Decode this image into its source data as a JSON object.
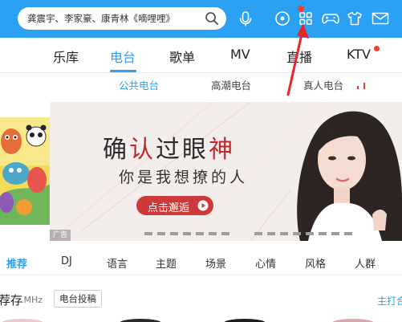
{
  "search": {
    "text": "龚震宇、李家豪、康青林《嘀哩哩》"
  },
  "main_nav": {
    "items": [
      "乐库",
      "电台",
      "歌单",
      "MV",
      "直播",
      "KTV"
    ],
    "active": "电台"
  },
  "sub_nav": {
    "items": [
      "公共电台",
      "高潮电台",
      "真人电台"
    ],
    "active": "公共电台"
  },
  "banner": {
    "headline": "确认过眼神",
    "subline": "你是我想撩的人",
    "button": "点击邂逅",
    "ad_badge": "广告"
  },
  "categories": {
    "items": [
      "推荐",
      "DJ",
      "语言",
      "主题",
      "场景",
      "心情",
      "风格",
      "人群"
    ],
    "active": "推荐"
  },
  "section": {
    "title": "荐存",
    "unit": ".MHz",
    "submit_button": "电台投稿",
    "right_link": "主打合"
  },
  "colors": {
    "accent": "#2aa1f2",
    "badge_red": "#ff3b30",
    "banner_button": "#cc3b3a",
    "banner_red_text": "#c0272d"
  },
  "icons": [
    "search-icon",
    "mic-icon",
    "radio-icon",
    "grid-icon",
    "gamepad-icon",
    "shirt-icon",
    "mail-icon",
    "play-icon"
  ]
}
